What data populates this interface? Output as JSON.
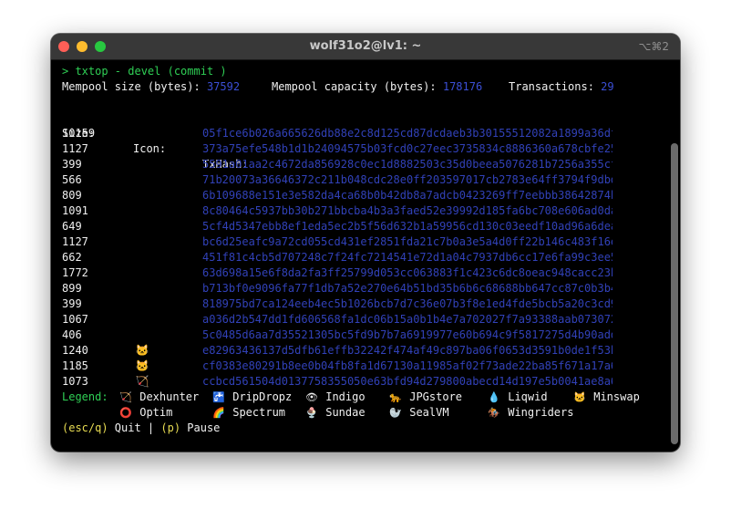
{
  "window": {
    "title": "wolf31o2@lv1: ~",
    "shortcut": "⌥⌘2"
  },
  "prompt": "> txtop - devel (commit )",
  "stats": {
    "mempool_size_label": "Mempool size (bytes): ",
    "mempool_size_value": "37592",
    "capacity_label": "Mempool capacity (bytes): ",
    "capacity_value": "178176",
    "transactions_label": "Transactions: ",
    "transactions_value": "29"
  },
  "table": {
    "headers": {
      "size": "Size:",
      "icon": "Icon:",
      "hash": "TxHash:"
    },
    "rows": [
      {
        "size": "10159",
        "icon": "",
        "hash": "05f1ce6b026a665626db88e2c8d125cd87dcdaeb3b30155512082a1899a36dfc"
      },
      {
        "size": "1127",
        "icon": "",
        "hash": "373a75efe548b1d1b24094575b03fcd0c27eec3735834c8886360a678cbfe253"
      },
      {
        "size": "399",
        "icon": "",
        "hash": "5591a01aa2c4672da856928c0ec1d8882503c35d0beea5076281b7256a355cfb"
      },
      {
        "size": "566",
        "icon": "",
        "hash": "71b20073a36646372c211b048cdc28e0ff203597017cb2783e64ff3794f9dbd4"
      },
      {
        "size": "809",
        "icon": "",
        "hash": "6b109688e151e3e582da4ca68b0b42db8a7adcb0423269ff7eebbb38642874bf"
      },
      {
        "size": "1091",
        "icon": "",
        "hash": "8c80464c5937bb30b271bbcba4b3a3faed52e39992d185fa6bc708e606ad0da9"
      },
      {
        "size": "649",
        "icon": "",
        "hash": "5cf4d5347ebb8ef1eda5ec2b5f56d632b1a59956cd130c03eedf10ad96a6deae"
      },
      {
        "size": "1127",
        "icon": "",
        "hash": "bc6d25eafc9a72cd055cd431ef2851fda21c7b0a3e5a4d0ff22b146c483f16e8"
      },
      {
        "size": "662",
        "icon": "",
        "hash": "451f81c4cb5d707248c7f24fc7214541e72d1a04c7937db6cc17e6fa99c3ee57"
      },
      {
        "size": "1772",
        "icon": "",
        "hash": "63d698a15e6f8da2fa3ff25799d053cc063883f1c423c6dc8oeac948cacc23b3"
      },
      {
        "size": "899",
        "icon": "",
        "hash": "b713bf0e9096fa77f1db7a52e270e64b51bd35b6b6c68688bb647cc87c0b3b4f"
      },
      {
        "size": "399",
        "icon": "",
        "hash": "818975bd7ca124eeb4ec5b1026bcb7d7c36e07b3f8e1ed4fde5bcb5a20c3cd9f"
      },
      {
        "size": "1067",
        "icon": "",
        "hash": "a036d2b547dd1fd606568fa1dc06b15a0b1b4e7a702027f7a93388aab073072c"
      },
      {
        "size": "406",
        "icon": "",
        "hash": "5c0485d6aa7d35521305bc5fd9b7b7a6919977e60b694c9f5817275d4b90add"
      },
      {
        "size": "1240",
        "icon": "🐱",
        "hash": "e82963436137d5dfb61effb32242f474af49c897ba06f0653d3591b0de1f53b1"
      },
      {
        "size": "1185",
        "icon": "🐱",
        "hash": "cf0383e80291b8ee0b04fb8fa1d67130a11985af02f73ade22ba85f671a17a64"
      },
      {
        "size": "1073",
        "icon": "🏹",
        "hash": "ccbcd561504d0137758355050e63bfd94d279800abecd14d197e5b0041ae8a60"
      }
    ]
  },
  "legend": {
    "label": "Legend:",
    "items": [
      {
        "icon": "🏹",
        "name": "Dexhunter"
      },
      {
        "icon": "🚰",
        "name": "DripDropz"
      },
      {
        "icon": "👁",
        "name": "Indigo"
      },
      {
        "icon": "🐆",
        "name": "JPGstore"
      },
      {
        "icon": "💧",
        "name": "Liqwid"
      },
      {
        "icon": "🐱",
        "name": "Minswap"
      },
      {
        "icon": "⭕",
        "name": "Optim"
      },
      {
        "icon": "🌈",
        "name": "Spectrum"
      },
      {
        "icon": "🍨",
        "name": "Sundae"
      },
      {
        "icon": "🦭",
        "name": "SealVM"
      },
      {
        "icon": "🏇",
        "name": "Wingriders"
      }
    ]
  },
  "footer": {
    "quit_key": "(esc/q)",
    "quit_label": " Quit | ",
    "pause_key": "(p)",
    "pause_label": " Pause"
  },
  "colors": {
    "prompt": "#2fcf55",
    "value": "#3b4fd6",
    "hash": "#3141b8",
    "keys": "#e8dc52"
  }
}
